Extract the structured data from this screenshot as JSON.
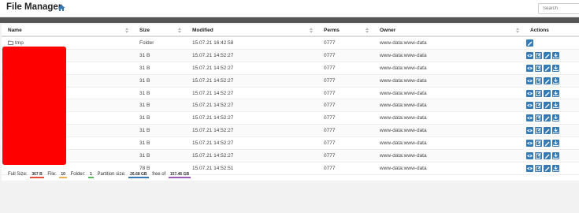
{
  "app": {
    "title": "File Manager"
  },
  "search": {
    "placeholder": "Search"
  },
  "table": {
    "headers": {
      "name": "Name",
      "size": "Size",
      "modified": "Modified",
      "perms": "Perms",
      "owner": "Owner",
      "actions": "Actions"
    },
    "rows": [
      {
        "name": "tmp",
        "size": "Folder",
        "modified": "15.07.21 16:42:58",
        "perms": "0777",
        "owner": "www-data:www-data",
        "folder": true
      },
      {
        "name": "",
        "size": "31 B",
        "modified": "15.07.21 14:52:27",
        "perms": "0777",
        "owner": "www-data:www-data"
      },
      {
        "name": "",
        "size": "31 B",
        "modified": "15.07.21 14:52:27",
        "perms": "0777",
        "owner": "www-data:www-data"
      },
      {
        "name": "",
        "size": "31 B",
        "modified": "15.07.21 14:52:27",
        "perms": "0777",
        "owner": "www-data:www-data"
      },
      {
        "name": "",
        "size": "31 B",
        "modified": "15.07.21 14:52:27",
        "perms": "0777",
        "owner": "www-data:www-data"
      },
      {
        "name": "",
        "size": "31 B",
        "modified": "15.07.21 14:52:27",
        "perms": "0777",
        "owner": "www-data:www-data"
      },
      {
        "name": "",
        "size": "31 B",
        "modified": "15.07.21 14:52:27",
        "perms": "0777",
        "owner": "www-data:www-data"
      },
      {
        "name": "",
        "size": "31 B",
        "modified": "15.07.21 14:52:27",
        "perms": "0777",
        "owner": "www-data:www-data"
      },
      {
        "name": "",
        "size": "31 B",
        "modified": "15.07.21 14:52:27",
        "perms": "0777",
        "owner": "www-data:www-data"
      },
      {
        "name": "",
        "size": "31 B",
        "modified": "15.07.21 14:52:27",
        "perms": "0777",
        "owner": "www-data:www-data"
      },
      {
        "name": "",
        "size": "78 B",
        "modified": "15.07.21 14:52:51",
        "perms": "0777",
        "owner": "www-data:www-data"
      }
    ]
  },
  "footer": {
    "full_size_label": "Full Size:",
    "full_size": "367 B",
    "file_label": "File:",
    "file": "10",
    "folder_label": "Folder:",
    "folder": "1",
    "partition_label": "Partition size:",
    "partition": "26.68 GB",
    "free_label": "free of",
    "free": "157.46 GB"
  },
  "colors": {
    "accent": "#337ab7",
    "redaction": "#ff0000"
  }
}
